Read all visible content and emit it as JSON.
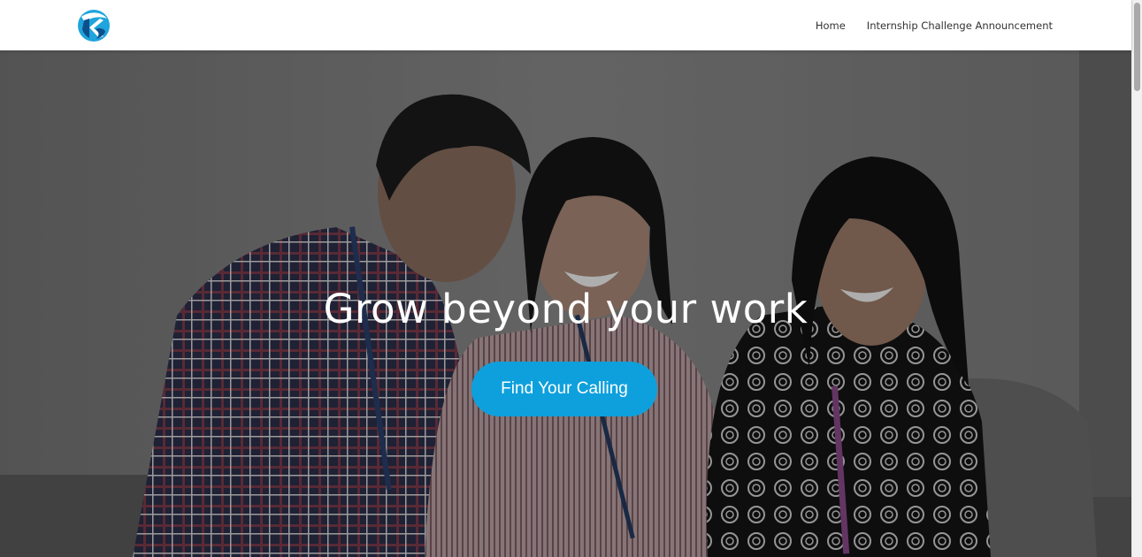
{
  "header": {
    "logo_icon": "company-logo-icon",
    "nav": [
      {
        "label": "Home"
      },
      {
        "label": "Internship Challenge Announcement"
      }
    ]
  },
  "hero": {
    "title": "Grow beyond your work",
    "cta_label": "Find Your Calling",
    "cta_color": "#0ea0dc",
    "photo_icon": "team-photo"
  },
  "colors": {
    "brand": "#0ea0dc",
    "logo_dark": "#0d4f8c",
    "logo_light": "#1fa4dc"
  }
}
